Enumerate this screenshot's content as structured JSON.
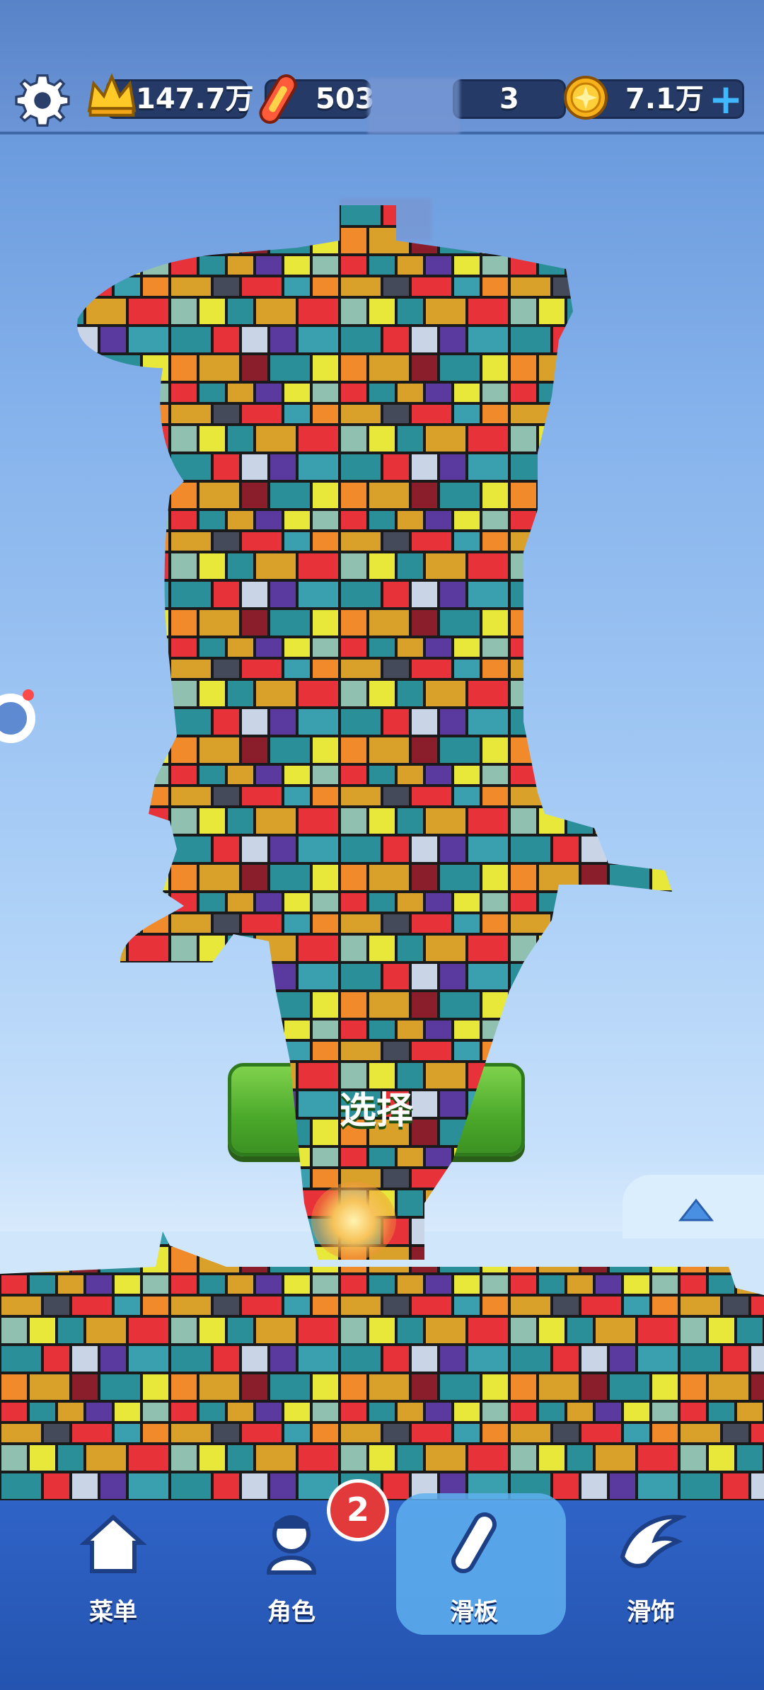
{
  "hud": {
    "crown_value": "147.7万",
    "board_value": "503",
    "middle_value": "3",
    "coin_value": "7.1万",
    "icons": [
      "gear-icon",
      "crown-icon",
      "skateboard-icon",
      "coin-icon",
      "plus-icon"
    ]
  },
  "main": {
    "select_label": "选择"
  },
  "nav": {
    "badge": "2",
    "items": [
      {
        "label": "菜单",
        "icon": "home-icon"
      },
      {
        "label": "角色",
        "icon": "character-icon"
      },
      {
        "label": "滑板",
        "icon": "skateboard-icon"
      },
      {
        "label": "滑饰",
        "icon": "wings-icon"
      }
    ]
  },
  "colors": {
    "sky_top": "#5f8fd6",
    "nav": "#2454b0",
    "button_green": "#4aa82a",
    "badge_red": "#e23a3a"
  }
}
